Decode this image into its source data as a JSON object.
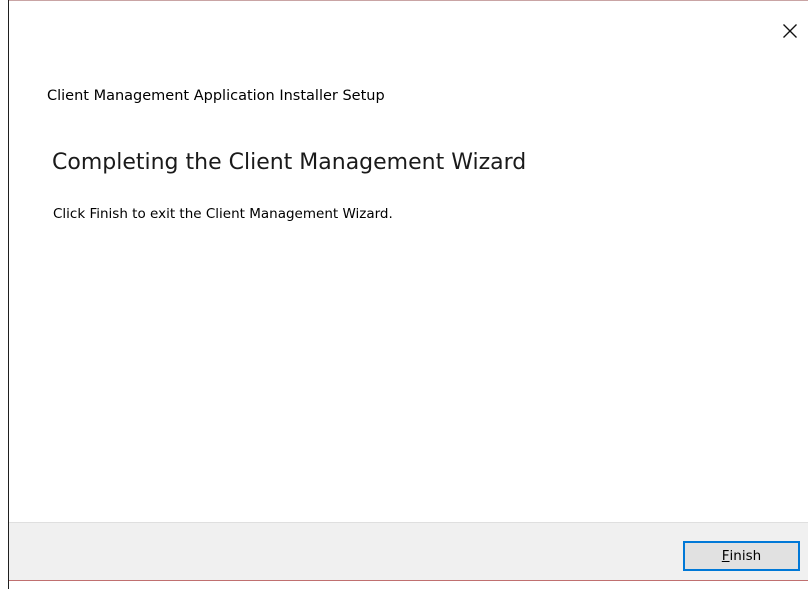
{
  "window": {
    "title": "Client Management Application Installer Setup",
    "close_icon": "close-icon"
  },
  "content": {
    "heading": "Completing the Client Management Wizard",
    "body": "Click Finish to exit the Client Management Wizard."
  },
  "footer": {
    "finish_label_mnemonic": "F",
    "finish_label_rest": "inish"
  },
  "colors": {
    "button_focus_border": "#0078d7",
    "footer_background": "#f0f0f0",
    "button_background": "#e1e1e1"
  }
}
